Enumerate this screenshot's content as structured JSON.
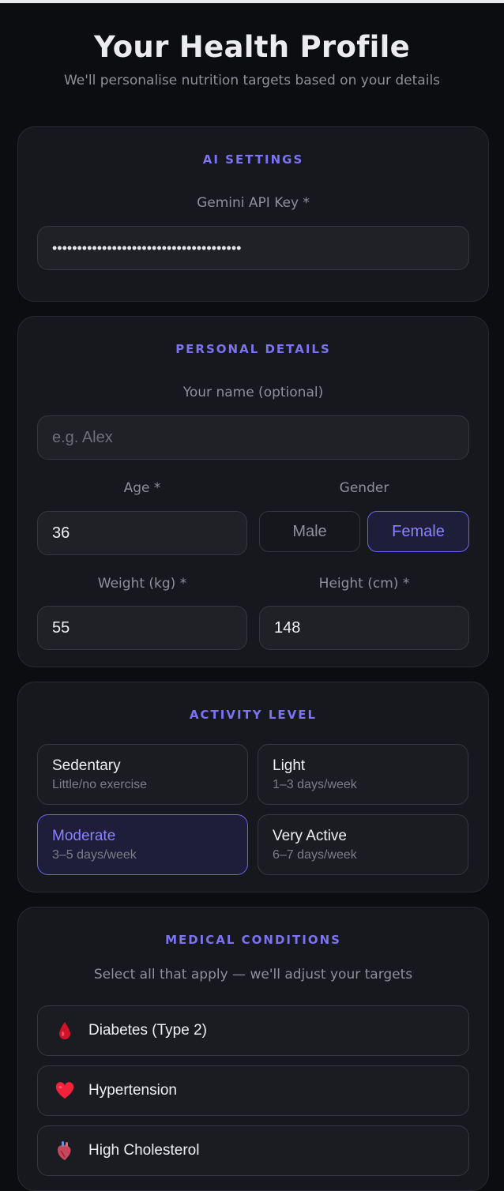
{
  "header": {
    "title": "Your Health Profile",
    "subtitle": "We'll personalise nutrition targets based on your details"
  },
  "ai_settings": {
    "section_title": "AI SETTINGS",
    "api_key_label": "Gemini API Key *",
    "api_key_value": "••••••••••••••••••••••••••••••••••••••"
  },
  "personal": {
    "section_title": "PERSONAL DETAILS",
    "name_label": "Your name (optional)",
    "name_placeholder": "e.g. Alex",
    "age_label": "Age *",
    "age_value": "36",
    "gender_label": "Gender",
    "gender_options": [
      "Male",
      "Female"
    ],
    "gender_selected": "Female",
    "weight_label": "Weight (kg) *",
    "weight_value": "55",
    "height_label": "Height (cm) *",
    "height_value": "148"
  },
  "activity": {
    "section_title": "ACTIVITY LEVEL",
    "options": [
      {
        "title": "Sedentary",
        "sub": "Little/no exercise"
      },
      {
        "title": "Light",
        "sub": "1–3 days/week"
      },
      {
        "title": "Moderate",
        "sub": "3–5 days/week"
      },
      {
        "title": "Very Active",
        "sub": "6–7 days/week"
      }
    ],
    "selected": "Moderate"
  },
  "medical": {
    "section_title": "MEDICAL CONDITIONS",
    "hint": "Select all that apply — we'll adjust your targets",
    "conditions": [
      {
        "label": "Diabetes (Type 2)",
        "icon": "blood-drop-icon"
      },
      {
        "label": "Hypertension",
        "icon": "heart-icon"
      },
      {
        "label": "High Cholesterol",
        "icon": "anatomical-heart-icon"
      }
    ]
  },
  "colors": {
    "accent": "#7b73f2",
    "background": "#0c0d11",
    "card": "#17181d"
  }
}
